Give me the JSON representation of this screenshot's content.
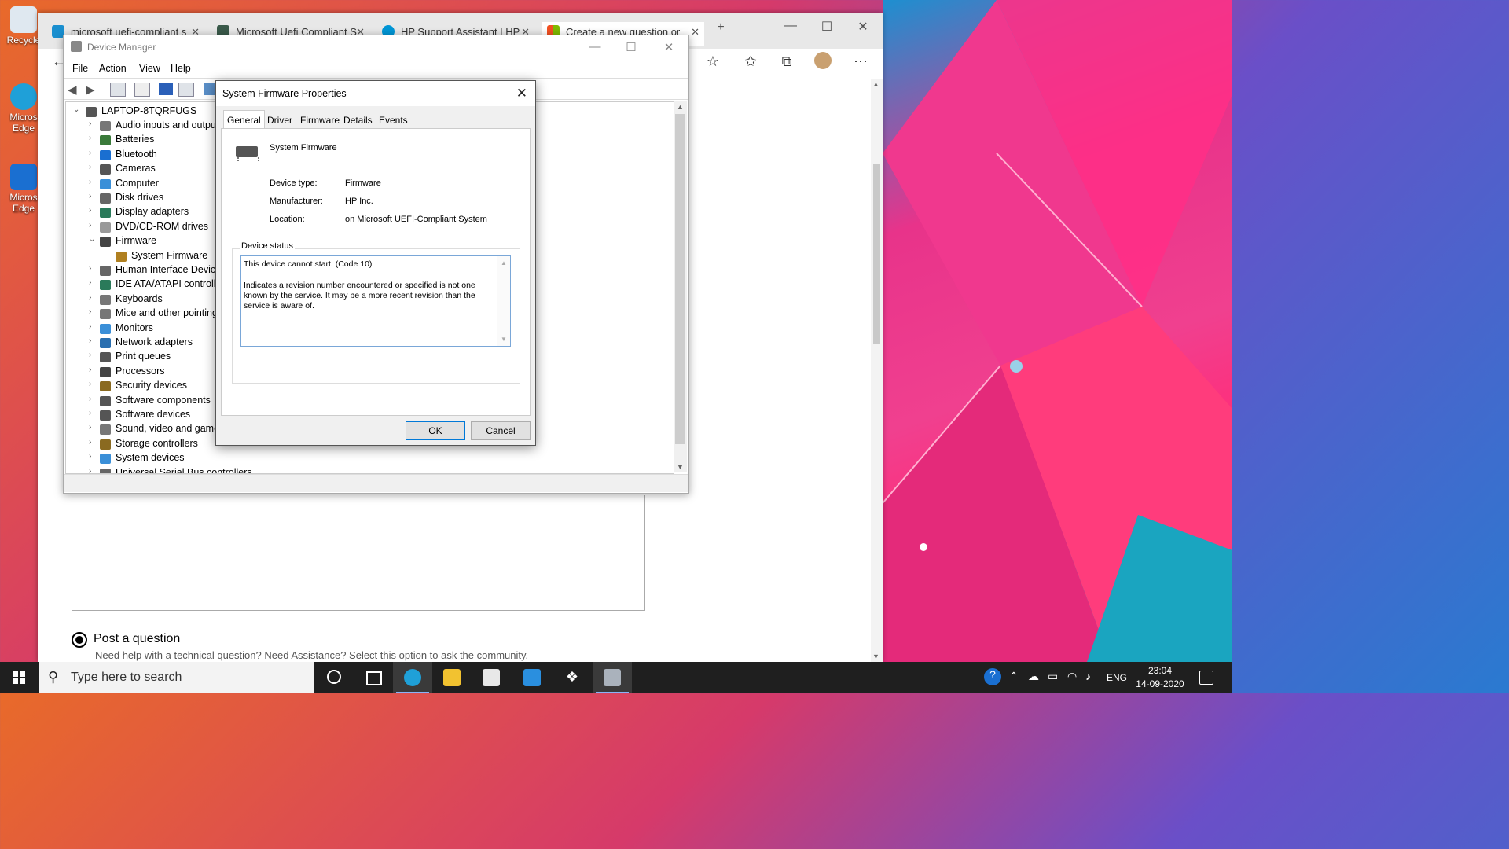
{
  "desktop": {
    "icons": [
      {
        "label": "Recycle"
      },
      {
        "label": "Micros Edge"
      },
      {
        "label": "Micros Edge"
      }
    ]
  },
  "browser": {
    "tabs": [
      {
        "title": "microsoft uefi-compliant s"
      },
      {
        "title": "Microsoft Uefi Compliant S"
      },
      {
        "title": "HP Support Assistant | HP"
      },
      {
        "title": "Create a new question or"
      }
    ],
    "new_tab": "+",
    "page": {
      "post_option_label": "Post a question",
      "post_option_desc": "Need help with a technical question? Need Assistance? Select this option to ask the community."
    }
  },
  "device_manager": {
    "title": "Device Manager",
    "menu": [
      "File",
      "Action",
      "View",
      "Help"
    ],
    "root": "LAPTOP-8TQRFUGS",
    "tree": [
      {
        "label": "Audio inputs and outpu",
        "color": "#777777",
        "expanded": false
      },
      {
        "label": "Batteries",
        "color": "#3a7a3a",
        "expanded": false
      },
      {
        "label": "Bluetooth",
        "color": "#1a6fd1",
        "expanded": false
      },
      {
        "label": "Cameras",
        "color": "#555555",
        "expanded": false
      },
      {
        "label": "Computer",
        "color": "#3a8fd8",
        "expanded": false
      },
      {
        "label": "Disk drives",
        "color": "#666666",
        "expanded": false
      },
      {
        "label": "Display adapters",
        "color": "#2a7a5a",
        "expanded": false
      },
      {
        "label": "DVD/CD-ROM drives",
        "color": "#999999",
        "expanded": false
      },
      {
        "label": "Firmware",
        "color": "#444444",
        "expanded": true
      },
      {
        "label": "System Firmware",
        "color": "#b08020",
        "child": true
      },
      {
        "label": "Human Interface Device",
        "color": "#666666",
        "expanded": false
      },
      {
        "label": "IDE ATA/ATAPI controllers",
        "color": "#2a7a5a",
        "expanded": false
      },
      {
        "label": "Keyboards",
        "color": "#777777",
        "expanded": false
      },
      {
        "label": "Mice and other pointing",
        "color": "#777777",
        "expanded": false
      },
      {
        "label": "Monitors",
        "color": "#3a8fd8",
        "expanded": false
      },
      {
        "label": "Network adapters",
        "color": "#2a6fb0",
        "expanded": false
      },
      {
        "label": "Print queues",
        "color": "#555555",
        "expanded": false
      },
      {
        "label": "Processors",
        "color": "#444444",
        "expanded": false
      },
      {
        "label": "Security devices",
        "color": "#8a6a20",
        "expanded": false
      },
      {
        "label": "Software components",
        "color": "#555555",
        "expanded": false
      },
      {
        "label": "Software devices",
        "color": "#555555",
        "expanded": false
      },
      {
        "label": "Sound, video and game",
        "color": "#777777",
        "expanded": false
      },
      {
        "label": "Storage controllers",
        "color": "#8a6a20",
        "expanded": false
      },
      {
        "label": "System devices",
        "color": "#3a8fd8",
        "expanded": false
      },
      {
        "label": "Universal Serial Bus controllers",
        "color": "#666666",
        "expanded": false
      }
    ]
  },
  "properties": {
    "title": "System Firmware Properties",
    "tabs": [
      "General",
      "Driver",
      "Firmware",
      "Details",
      "Events"
    ],
    "active_tab": "General",
    "device_name": "System Firmware",
    "device_type_label": "Device type:",
    "device_type": "Firmware",
    "manufacturer_label": "Manufacturer:",
    "manufacturer": "HP Inc.",
    "location_label": "Location:",
    "location": "on Microsoft UEFI-Compliant System",
    "status_label": "Device status",
    "status_line1": "This device cannot start. (Code 10)",
    "status_line2": "Indicates a revision number encountered or specified is not one known by the service. It may be a more recent revision than the service is aware of.",
    "ok": "OK",
    "cancel": "Cancel"
  },
  "taskbar": {
    "search_placeholder": "Type here to search",
    "lang": "ENG",
    "time": "23:04",
    "date": "14-09-2020"
  }
}
